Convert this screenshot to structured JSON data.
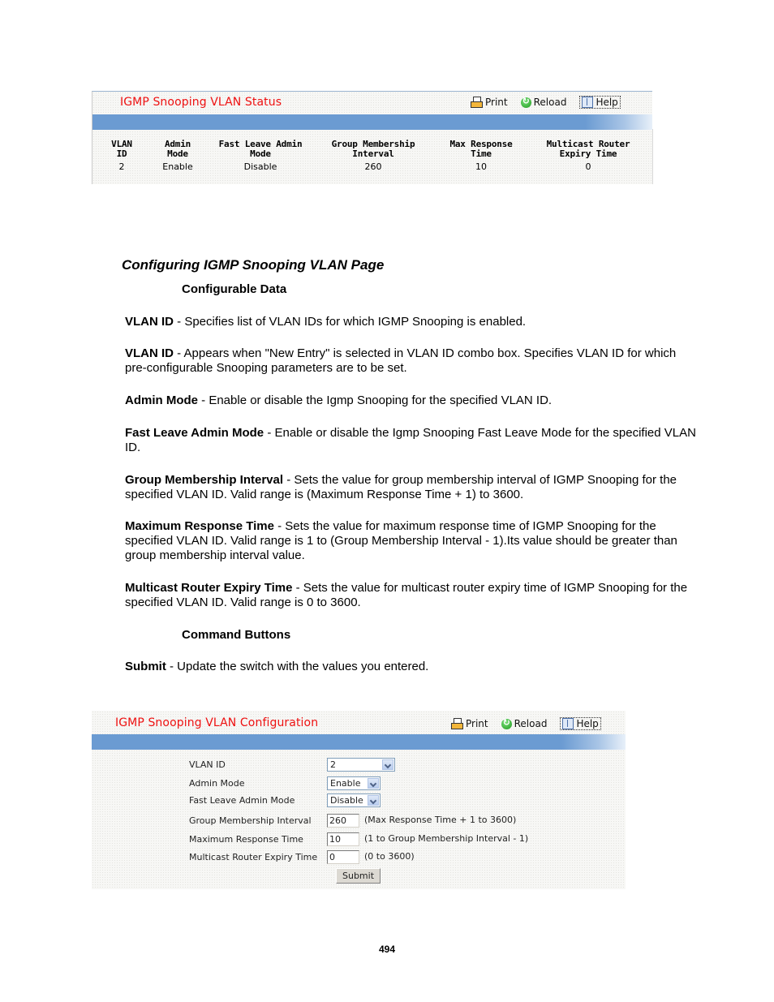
{
  "status_panel": {
    "title": "IGMP Snooping VLAN Status",
    "toolbar": {
      "print_label": "Print",
      "reload_label": "Reload",
      "help_label": "Help"
    },
    "columns": [
      {
        "line1": "VLAN",
        "line2": "ID",
        "value": "2"
      },
      {
        "line1": "Admin",
        "line2": "Mode",
        "value": "Enable"
      },
      {
        "line1": "Fast Leave Admin",
        "line2": "Mode",
        "value": "Disable"
      },
      {
        "line1": "Group Membership",
        "line2": "Interval",
        "value": "260"
      },
      {
        "line1": "Max Response",
        "line2": "Time",
        "value": "10"
      },
      {
        "line1": "Multicast Router",
        "line2": "Expiry Time",
        "value": "0"
      }
    ]
  },
  "document": {
    "heading": "Configuring IGMP Snooping VLAN Page",
    "subheading_configurable": "Configurable Data",
    "paragraphs": [
      {
        "term": "VLAN ID",
        "text": " - Specifies list of VLAN IDs for which IGMP Snooping is enabled."
      },
      {
        "term": "VLAN ID",
        "text": " - Appears when \"New Entry\" is selected in VLAN ID combo box. Specifies VLAN ID for which pre-configurable Snooping parameters are to be set."
      },
      {
        "term": "Admin Mode",
        "text": " - Enable or disable the Igmp Snooping for the specified VLAN ID."
      },
      {
        "term": "Fast Leave Admin Mode",
        "text": " - Enable or disable the Igmp Snooping Fast Leave Mode for the specified VLAN ID."
      },
      {
        "term": "Group Membership Interval",
        "text": " - Sets the value for group membership interval of IGMP Snooping for the specified VLAN ID. Valid range is (Maximum Response Time + 1) to 3600."
      },
      {
        "term": "Maximum Response Time",
        "text": " - Sets the value for maximum response time of IGMP Snooping for the specified VLAN ID. Valid range is 1 to (Group Membership Interval - 1).Its value should be greater than group membership interval value."
      },
      {
        "term": "Multicast Router Expiry Time",
        "text": " - Sets the value for multicast router expiry time of IGMP Snooping for the specified VLAN ID. Valid range is 0 to 3600."
      }
    ],
    "subheading_commands": "Command Buttons",
    "command_paragraph": {
      "term": "Submit",
      "text": " - Update the switch with the values you entered."
    },
    "page_number": "494"
  },
  "config_panel": {
    "title": "IGMP Snooping VLAN Configuration",
    "toolbar": {
      "print_label": "Print",
      "reload_label": "Reload",
      "help_label": "Help"
    },
    "fields": {
      "vlan_id": {
        "label": "VLAN ID",
        "value": "2"
      },
      "admin_mode": {
        "label": "Admin Mode",
        "value": "Enable"
      },
      "fast_leave": {
        "label": "Fast Leave Admin Mode",
        "value": "Disable"
      },
      "group_membership": {
        "label": "Group Membership Interval",
        "value": "260",
        "hint": "(Max Response Time + 1 to 3600)"
      },
      "max_response": {
        "label": "Maximum Response Time",
        "value": "10",
        "hint": "(1 to Group Membership Interval - 1)"
      },
      "router_expiry": {
        "label": "Multicast Router Expiry Time",
        "value": "0",
        "hint": "(0 to 3600)"
      }
    },
    "submit_label": "Submit"
  },
  "colors": {
    "title_red": "#ee1111",
    "header_bar_blue": "#6b9bd2"
  }
}
